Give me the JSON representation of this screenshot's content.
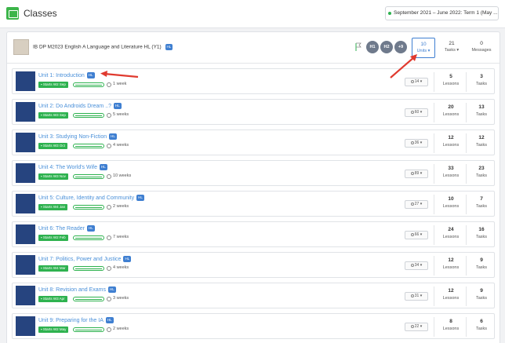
{
  "app": {
    "title": "Classes",
    "term": "September 2021 – June 2022: Term 1 (May ..."
  },
  "class": {
    "title": "IB DP M2023 English A Language and Literature HL (Y1)",
    "level_badge": "HL",
    "groups": [
      "H1",
      "H2",
      "+9"
    ],
    "units": {
      "count": "10",
      "label": "Units"
    },
    "tasks": {
      "count": "21",
      "label": "Tasks"
    },
    "messages": {
      "count": "0",
      "label": "Messages"
    }
  },
  "labels": {
    "lessons": "Lessons",
    "tasks": "Tasks"
  },
  "units": [
    {
      "title": "Unit 1: Introduction",
      "badge": "HL",
      "start": "Starts W2 Sep",
      "duration": "1 week",
      "resources": "14",
      "lessons": "5",
      "tasks": "3"
    },
    {
      "title": "Unit 2: Do Androids Dream ..?",
      "badge": "HL",
      "start": "Starts W3 Sep",
      "duration": "5 weeks",
      "resources": "60",
      "lessons": "20",
      "tasks": "13"
    },
    {
      "title": "Unit 3: Studying Non-Fiction",
      "badge": "HL",
      "start": "Starts W3 Oct",
      "duration": "4 weeks",
      "resources": "36",
      "lessons": "12",
      "tasks": "12"
    },
    {
      "title": "Unit 4: The World's Wife",
      "badge": "HL",
      "start": "Starts W3 Nov",
      "duration": "10 weeks",
      "resources": "89",
      "lessons": "33",
      "tasks": "23"
    },
    {
      "title": "Unit 5: Culture, Identity and Community",
      "badge": "HL",
      "start": "Starts W4 Jan",
      "duration": "2 weeks",
      "resources": "27",
      "lessons": "10",
      "tasks": "7"
    },
    {
      "title": "Unit 6: The Reader",
      "badge": "HL",
      "start": "Starts W2 Feb",
      "duration": "7 weeks",
      "resources": "66",
      "lessons": "24",
      "tasks": "16"
    },
    {
      "title": "Unit 7: Politics, Power and Justice",
      "badge": "HL",
      "start": "Starts W4 Mar",
      "duration": "4 weeks",
      "resources": "34",
      "lessons": "12",
      "tasks": "9"
    },
    {
      "title": "Unit 8: Revision and Exams",
      "badge": "HL",
      "start": "Starts W3 Apr",
      "duration": "3 weeks",
      "resources": "31",
      "lessons": "12",
      "tasks": "9"
    },
    {
      "title": "Unit 9: Preparing for the IA",
      "badge": "HL",
      "start": "Starts W2 May",
      "duration": "2 weeks",
      "resources": "22",
      "lessons": "8",
      "tasks": "6"
    }
  ],
  "colors": {
    "accent": "#3f7fd1",
    "start_green": "#2eb24f",
    "thumb": "#26447f",
    "annotation": "#e03a2f"
  }
}
